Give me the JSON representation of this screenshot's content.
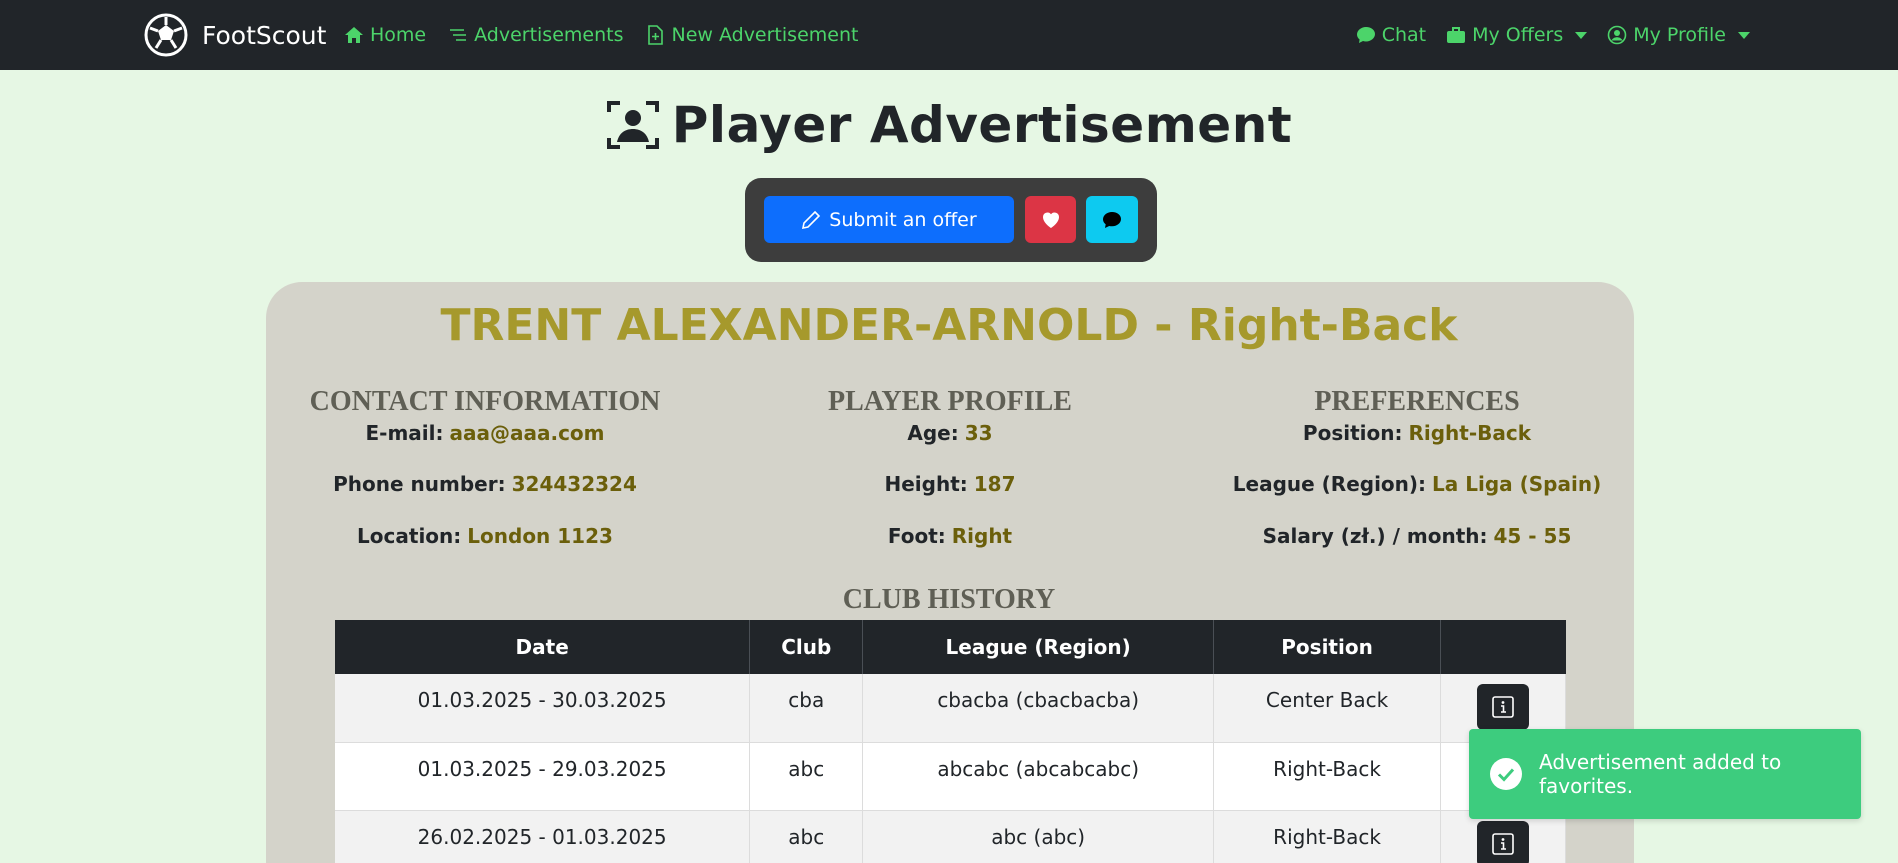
{
  "navbar": {
    "brand": "FootScout",
    "links": {
      "home": "Home",
      "advertisements": "Advertisements",
      "new_advertisement": "New Advertisement",
      "chat": "Chat",
      "my_offers": "My Offers",
      "my_profile": "My Profile"
    }
  },
  "page": {
    "title": "Player Advertisement"
  },
  "actions": {
    "submit_offer": "Submit an offer"
  },
  "player": {
    "heading": "TRENT ALEXANDER-ARNOLD - Right-Back"
  },
  "contact": {
    "title": "CONTACT INFORMATION",
    "email_label": "E-mail:",
    "email": "aaa@aaa.com",
    "phone_label": "Phone number:",
    "phone": "324432324",
    "location_label": "Location:",
    "location": "London 1123"
  },
  "profile": {
    "title": "PLAYER PROFILE",
    "age_label": "Age:",
    "age": "33",
    "height_label": "Height:",
    "height": "187",
    "foot_label": "Foot:",
    "foot": "Right"
  },
  "preferences": {
    "title": "PREFERENCES",
    "position_label": "Position:",
    "position": "Right-Back",
    "league_label": "League (Region):",
    "league": "La Liga (Spain)",
    "salary_label": "Salary (zł.) / month:",
    "salary": "45 - 55"
  },
  "history": {
    "title": "CLUB HISTORY",
    "columns": [
      "Date",
      "Club",
      "League (Region)",
      "Position",
      ""
    ],
    "rows": [
      {
        "date": "01.03.2025 - 30.03.2025",
        "club": "cba",
        "league": "cbacba (cbacbacba)",
        "position": "Center Back"
      },
      {
        "date": "01.03.2025 - 29.03.2025",
        "club": "abc",
        "league": "abcabc (abcabcabc)",
        "position": "Right-Back"
      },
      {
        "date": "26.02.2025 - 01.03.2025",
        "club": "abc",
        "league": "abc (abc)",
        "position": "Right-Back"
      }
    ]
  },
  "toast": {
    "message": "Advertisement added to favorites."
  },
  "colors": {
    "accent_green": "#4cd46a",
    "name_gold": "#a6992c",
    "value_olive": "#6b5f0b",
    "toast_green": "#3dcc7e",
    "primary_blue": "#0d6efd",
    "danger_red": "#dc3545",
    "info_cyan": "#0dcaf0"
  }
}
